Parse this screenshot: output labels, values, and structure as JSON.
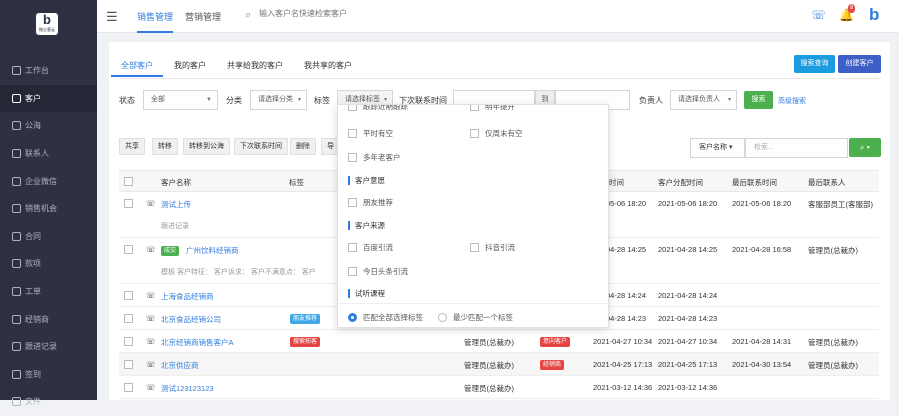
{
  "sidebar": {
    "logo_letter": "b",
    "logo_sub": "微企客云",
    "items": [
      {
        "label": "工作台"
      },
      {
        "label": "客户"
      },
      {
        "label": "公海"
      },
      {
        "label": "联系人"
      },
      {
        "label": "企业微信"
      },
      {
        "label": "销售机会"
      },
      {
        "label": "合同"
      },
      {
        "label": "款项"
      },
      {
        "label": "工单"
      },
      {
        "label": "经销商"
      },
      {
        "label": "跟进记录"
      },
      {
        "label": "签到"
      },
      {
        "label": "文件"
      }
    ]
  },
  "topbar": {
    "tabs": [
      "销售管理",
      "营销管理"
    ],
    "search_placeholder": "输入客户名快速检索客户",
    "notification_count": "8",
    "brand_letter": "b"
  },
  "subtabs": [
    "全部客户",
    "我的客户",
    "共享给我的客户",
    "我共享的客户"
  ],
  "buttons": {
    "crawl": "搜索查询",
    "create": "创建客户",
    "search": "搜索",
    "advanced": "高级搜索"
  },
  "filters": {
    "status_label": "状态",
    "status_value": "全部",
    "category_label": "分类",
    "category_value": "请选择分类",
    "tag_label": "标签",
    "tag_value": "请选择标签",
    "next_contact_label": "下次联系时间",
    "to": "到",
    "owner_label": "负责人",
    "owner_value": "请选择负责人"
  },
  "actions": [
    "共享",
    "转移",
    "转移到公海",
    "下次联系时间",
    "删除",
    "导"
  ],
  "right_search": {
    "field": "客户名称",
    "placeholder": "检索..."
  },
  "table": {
    "headers": [
      "客户名称",
      "标签",
      "时间",
      "客户分配时间",
      "最后联系时间",
      "最后联系人"
    ],
    "rows": [
      {
        "name": "测试上传",
        "tag": "",
        "owner": "",
        "tag2": "",
        "t1": "05-06 18:20",
        "t2": "2021-05-06 18:20",
        "t3": "2021-05-06 18:20",
        "contact": "客服部员工(客服部)",
        "sub": "跟进记录",
        "stage": "",
        "highlight": false
      },
      {
        "name": "广州饮料经销商",
        "stage": "成交",
        "tag": "",
        "owner": "",
        "tag2": "",
        "t1": "04-28 14:25",
        "t2": "2021-04-28 14:25",
        "t3": "2021-04-28 16:58",
        "contact": "管理员(总裁办)",
        "sub": "模板 客户特征：  客户诉求：  客户不满意点：  客户",
        "highlight": false
      },
      {
        "name": "上海食品经销商",
        "stage": "",
        "tag": "",
        "owner": "",
        "tag2": "",
        "t1": "04-28 14:24",
        "t2": "2021-04-28 14:24",
        "t3": "",
        "contact": "",
        "sub": "",
        "highlight": false
      },
      {
        "name": "北京食品经销公司",
        "stage": "",
        "tag": "朋友推荐",
        "owner": "",
        "tag2": "",
        "t1": "04-28 14:23",
        "t2": "2021-04-28 14:23",
        "t3": "",
        "contact": "",
        "sub": "",
        "highlight": false
      },
      {
        "name": "北京经销商销售客户A",
        "stage": "",
        "tag": "搜索拓客",
        "owner": "管理员(总裁办)",
        "tag2": "意向客户",
        "t1": "2021-04-27 10:34",
        "t2": "2021-04-27 10:34",
        "t3": "2021-04-28 14:31",
        "contact": "管理员(总裁办)",
        "sub": "",
        "highlight": false
      },
      {
        "name": "北京供应商",
        "stage": "",
        "tag": "",
        "owner": "管理员(总裁办)",
        "tag2": "经销商",
        "t1": "2021-04-25 17:13",
        "t2": "2021-04-25 17:13",
        "t3": "2021-04-30 13:54",
        "contact": "管理员(总裁办)",
        "sub": "",
        "highlight": true
      },
      {
        "name": "测试123123123",
        "stage": "",
        "tag": "",
        "owner": "管理员(总裁办)",
        "tag2": "",
        "t1": "2021-03-12 14:36",
        "t2": "2021-03-12 14:36",
        "t3": "",
        "contact": "",
        "sub": "",
        "highlight": false
      }
    ]
  },
  "tag_dropdown": {
    "row0_left": "跟踪近期跟踪",
    "row0_right": "明年提升",
    "opts_a": [
      "平时有空",
      "仅周末有空"
    ],
    "opt_b": "多年老客户",
    "group1": "客户意愿",
    "opt_c": "朋友推荐",
    "group2": "客户来源",
    "opts_d": [
      "百度引流",
      "抖音引流"
    ],
    "opt_e": "今日头条引流",
    "group3": "试听课程",
    "match_all": "匹配全部选择标签",
    "match_one": "最少匹配一个标签"
  },
  "colors": {
    "accent": "#2f7de1",
    "sidebar": "#2d3142",
    "green": "#4cb04f",
    "red": "#e64545"
  }
}
